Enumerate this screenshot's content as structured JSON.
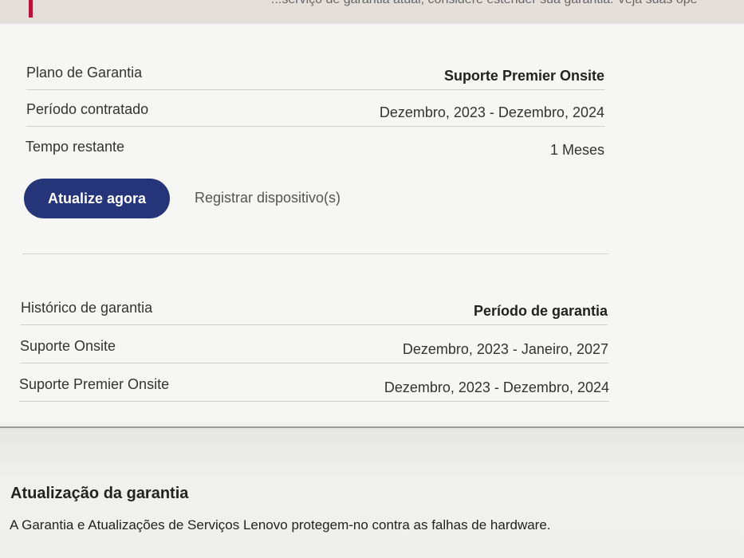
{
  "alert": {
    "text": "...serviço de garantia atual, considere estender sua garantia. Veja suas ope"
  },
  "warranty": {
    "rows": [
      {
        "label": "Plano de Garantia",
        "value": "Suporte Premier Onsite"
      },
      {
        "label": "Período contratado",
        "value": "Dezembro, 2023 - Dezembro, 2024"
      },
      {
        "label": "Tempo restante",
        "value": "1 Meses"
      }
    ],
    "update_button": "Atualize agora",
    "register_link": "Registrar dispositivo(s)"
  },
  "history": {
    "header_label": "Histórico de garantia",
    "header_value": "Período de garantia",
    "rows": [
      {
        "label": "Suporte Onsite",
        "value": "Dezembro, 2023 - Janeiro, 2027"
      },
      {
        "label": "Suporte Premier Onsite",
        "value": "Dezembro, 2023 - Dezembro, 2024"
      }
    ]
  },
  "upgrade": {
    "title": "Atualização da garantia",
    "description": "A Garantia e Atualizações de Serviços Lenovo protegem-no contra as falhas de hardware."
  },
  "colors": {
    "primary_button": "#26347a",
    "alert_accent": "#b8123a"
  }
}
